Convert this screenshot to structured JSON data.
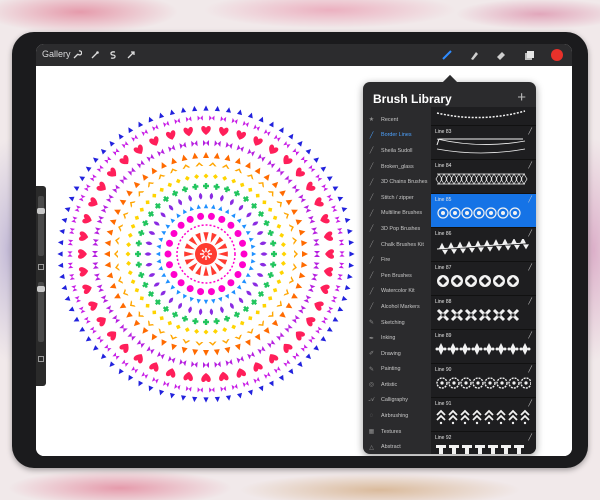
{
  "topbar": {
    "gallery_label": "Gallery",
    "left_icons": [
      "wrench-icon",
      "magic-wand-icon",
      "selection-icon",
      "transform-arrow-icon"
    ],
    "right_icons": [
      "brush-icon",
      "smudge-icon",
      "eraser-icon",
      "layers-icon",
      "color-swatch"
    ],
    "active_color": "#e8312a"
  },
  "brush_library": {
    "title": "Brush Library",
    "add_label": "+",
    "categories": [
      {
        "icon": "★",
        "label": "Recent"
      },
      {
        "icon": "╱",
        "label": "Border Lines",
        "active": true
      },
      {
        "icon": "╱",
        "label": "Sheila Sudoll"
      },
      {
        "icon": "╱",
        "label": "Broken_glass"
      },
      {
        "icon": "╱",
        "label": "3D Chains Brushes"
      },
      {
        "icon": "╱",
        "label": "Stitch / zipper"
      },
      {
        "icon": "╱",
        "label": "Multiline Brushes"
      },
      {
        "icon": "╱",
        "label": "3D Pop Brushes"
      },
      {
        "icon": "╱",
        "label": "Chalk Brushes Kit"
      },
      {
        "icon": "╱",
        "label": "Fire"
      },
      {
        "icon": "╱",
        "label": "Pen Brushes"
      },
      {
        "icon": "╱",
        "label": "Watercolor Kit"
      },
      {
        "icon": "╱",
        "label": "Alcohol Markers"
      },
      {
        "icon": "✎",
        "label": "Sketching"
      },
      {
        "icon": "✒",
        "label": "Inking"
      },
      {
        "icon": "✐",
        "label": "Drawing"
      },
      {
        "icon": "✎",
        "label": "Painting"
      },
      {
        "icon": "◎",
        "label": "Artistic"
      },
      {
        "icon": "𝒜",
        "label": "Calligraphy"
      },
      {
        "icon": "◌",
        "label": "Airbrushing"
      },
      {
        "icon": "▦",
        "label": "Textures"
      },
      {
        "icon": "△",
        "label": "Abstract"
      }
    ],
    "brushes": [
      {
        "name": "",
        "pattern": "stitch"
      },
      {
        "name": "Line 83",
        "pattern": "zigzag"
      },
      {
        "name": "Line 84",
        "pattern": "lattice"
      },
      {
        "name": "Line 85",
        "pattern": "flowers",
        "selected": true
      },
      {
        "name": "Line 86",
        "pattern": "triangles"
      },
      {
        "name": "Line 87",
        "pattern": "diamonds"
      },
      {
        "name": "Line 88",
        "pattern": "crosses"
      },
      {
        "name": "Line 89",
        "pattern": "fleurs"
      },
      {
        "name": "Line 90",
        "pattern": "rings"
      },
      {
        "name": "Line 91",
        "pattern": "arrows"
      },
      {
        "name": "Line 92",
        "pattern": "tees"
      }
    ]
  },
  "mandala_colors": [
    "#ff3b30",
    "#ff00cc",
    "#1e90ff",
    "#8a2be2",
    "#22c55e",
    "#ffd400",
    "#ffa500",
    "#ff6a00",
    "#b620e0",
    "#ff1f5a",
    "#c81ee6",
    "#2222dd"
  ]
}
